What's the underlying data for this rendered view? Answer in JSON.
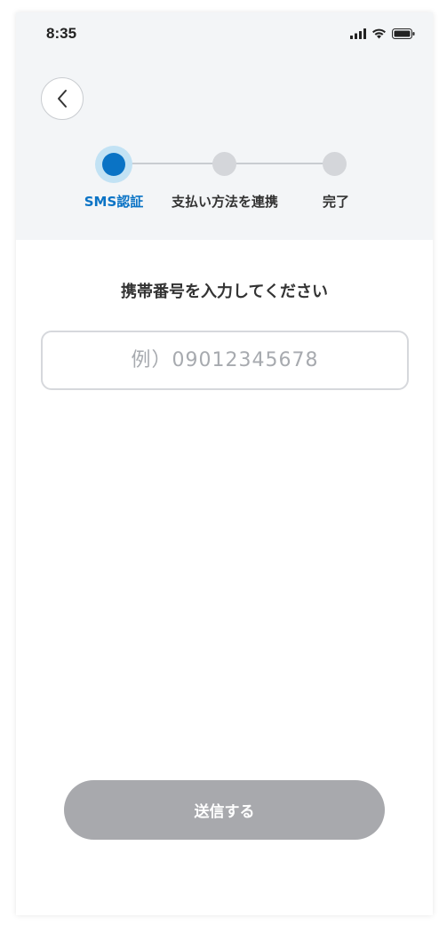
{
  "status_bar": {
    "time": "8:35",
    "icons": [
      "cellular-signal-icon",
      "wifi-icon",
      "battery-icon"
    ]
  },
  "header": {
    "back_icon": "chevron-left-icon"
  },
  "stepper": {
    "current_step": 1,
    "steps": [
      {
        "label": "SMS認証"
      },
      {
        "label": "支払い方法を連携"
      },
      {
        "label": "完了"
      }
    ]
  },
  "form": {
    "title": "携帯番号を入力してください",
    "phone_input": {
      "value": "",
      "placeholder": "例）09012345678"
    },
    "submit_label": "送信する"
  },
  "colors": {
    "accent": "#0a73c5",
    "accent_halo": "#c2e2f4",
    "header_bg": "#f3f5f7",
    "inactive_step": "#d4d6da",
    "disabled_button": "#a8a9ad"
  }
}
